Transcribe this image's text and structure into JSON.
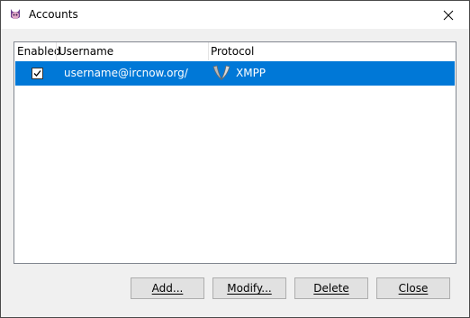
{
  "window": {
    "title": "Accounts"
  },
  "columns": {
    "enabled": "Enabled",
    "username": "Username",
    "protocol": "Protocol"
  },
  "accounts": [
    {
      "enabled": true,
      "username": "username@ircnow.org/",
      "protocol": "XMPP",
      "protocol_icon": "xmpp-icon"
    }
  ],
  "buttons": {
    "add": "Add...",
    "modify": "Modify...",
    "delete": "Delete",
    "close": "Close"
  },
  "colors": {
    "selection": "#0078d7",
    "dialog_bg": "#f0f0f0",
    "button_bg": "#e1e1e1"
  }
}
